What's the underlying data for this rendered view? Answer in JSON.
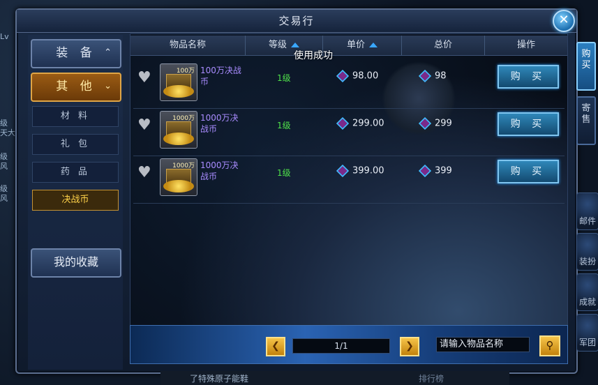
{
  "window": {
    "title": "交易行"
  },
  "categories": {
    "main": [
      {
        "label": "装 备",
        "arrow": "^",
        "active": false
      },
      {
        "label": "其 他",
        "arrow": "v",
        "active": true
      }
    ],
    "sub": [
      {
        "label": "材 料",
        "active": false
      },
      {
        "label": "礼 包",
        "active": false
      },
      {
        "label": "药 品",
        "active": false
      },
      {
        "label": "决战币",
        "active": true
      }
    ],
    "favorites_label": "我的收藏"
  },
  "table": {
    "headers": [
      "物品名称",
      "等级",
      "单价",
      "总价",
      "操作"
    ],
    "toast": "使用成功",
    "rows": [
      {
        "icon_tag": "100万",
        "name": "100万决战币",
        "level": "1级",
        "unit_price": "98.00",
        "total_price": "98",
        "buy_label": "购 买"
      },
      {
        "icon_tag": "1000万",
        "name": "1000万决战币",
        "level": "1级",
        "unit_price": "299.00",
        "total_price": "299",
        "buy_label": "购 买"
      },
      {
        "icon_tag": "1000万",
        "name": "1000万决战币",
        "level": "1级",
        "unit_price": "399.00",
        "total_price": "399",
        "buy_label": "购 买"
      }
    ]
  },
  "pager": {
    "prev_icon": "chevron-left-icon",
    "page_text": "1/1",
    "next_icon": "chevron-right-icon",
    "search_placeholder": "请输入物品名称"
  },
  "side_tabs": [
    {
      "label": "购买",
      "active": true
    },
    {
      "label": "寄售",
      "active": false
    }
  ],
  "side_buttons": [
    "邮件",
    "装扮",
    "成就",
    "军团"
  ],
  "background": {
    "left_labels": [
      "Lv",
      "级",
      "天大表",
      "级",
      "风",
      "级",
      "风"
    ],
    "bottom_text": "了特殊原子能鞋",
    "bottom_text2": "排行榜"
  },
  "colors": {
    "accent": "#2f87b9",
    "active_category": "#9a5b14",
    "level_green": "#4fe04a",
    "item_name_purple": "#a98cff"
  }
}
